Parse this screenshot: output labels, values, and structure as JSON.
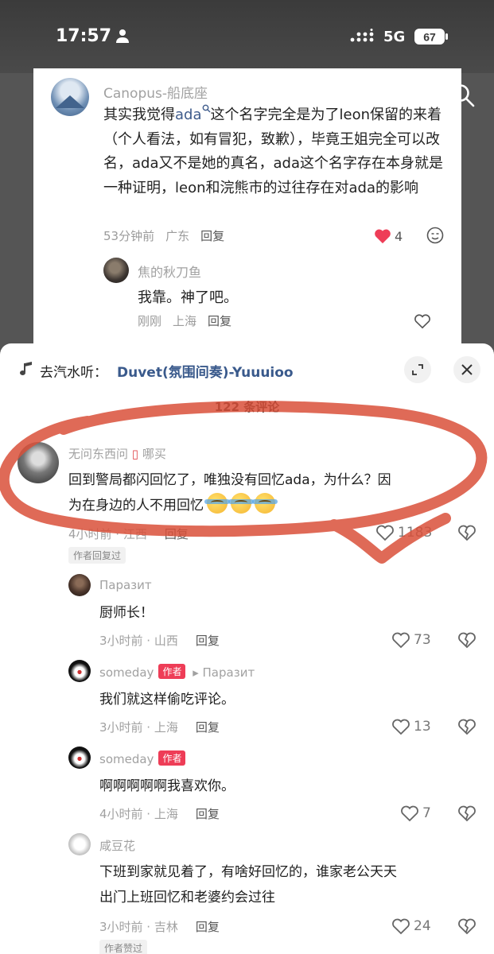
{
  "status_bar": {
    "time": "17:57",
    "network": "5G",
    "battery": "67"
  },
  "background_post": {
    "username": "Canopus-船底座",
    "text_pre": "其实我觉得",
    "highlight": "ada",
    "text_post": "这个名字完全是为了leon保留的来着（个人看法，如有冒犯，致歉），毕竟王姐完全可以改名，ada又不是她的真名，ada这个名字存在本身就是一种证明，leon和浣熊市的过往存在对ada的影响",
    "time": "53分钟前",
    "location": "广东",
    "reply_label": "回复",
    "likes": "4",
    "reply": {
      "username": "焦的秋刀鱼",
      "text": "我靠。神了吧。",
      "time": "刚刚",
      "location": "上海",
      "reply_label": "回复"
    }
  },
  "sheet": {
    "music_prefix": "去汽水听：",
    "music_title": "Duvet(氛围间奏)-Yuuuioo",
    "comment_count": "122 条评论"
  },
  "comments": [
    {
      "username": "无问东西问",
      "suffix": "哪买",
      "text_line1": "回到警局都闪回忆了，唯独没有回忆ada，为什么？因",
      "text_line2": "为在身边的人不用回忆",
      "meta": "4小时前 · 江西",
      "reply_label": "回复",
      "likes": "1183",
      "tag": "作者回复过"
    },
    {
      "username": "Паразит",
      "text": "厨师长！",
      "meta": "3小时前 · 山西",
      "reply_label": "回复",
      "likes": "73"
    },
    {
      "username": "someday",
      "badge": "作者",
      "reply_to": "Паразит",
      "text": "我们就这样偷吃评论。",
      "meta": "3小时前 · 上海",
      "reply_label": "回复",
      "likes": "13"
    },
    {
      "username": "someday",
      "badge": "作者",
      "text": "啊啊啊啊啊我喜欢你。",
      "meta": "4小时前 · 上海",
      "reply_label": "回复",
      "likes": "7"
    },
    {
      "username": "咸豆花",
      "text_line1": "下班到家就见着了，有啥好回忆的，谁家老公天天",
      "text_line2": "出门上班回忆和老婆约会过往",
      "meta": "3小时前 · 吉林",
      "reply_label": "回复",
      "likes": "24",
      "tag": "作者赞过"
    }
  ],
  "colors": {
    "accent_red": "#ee3d57",
    "music_blue": "#3a5a8c",
    "scribble": "#d9503a"
  }
}
